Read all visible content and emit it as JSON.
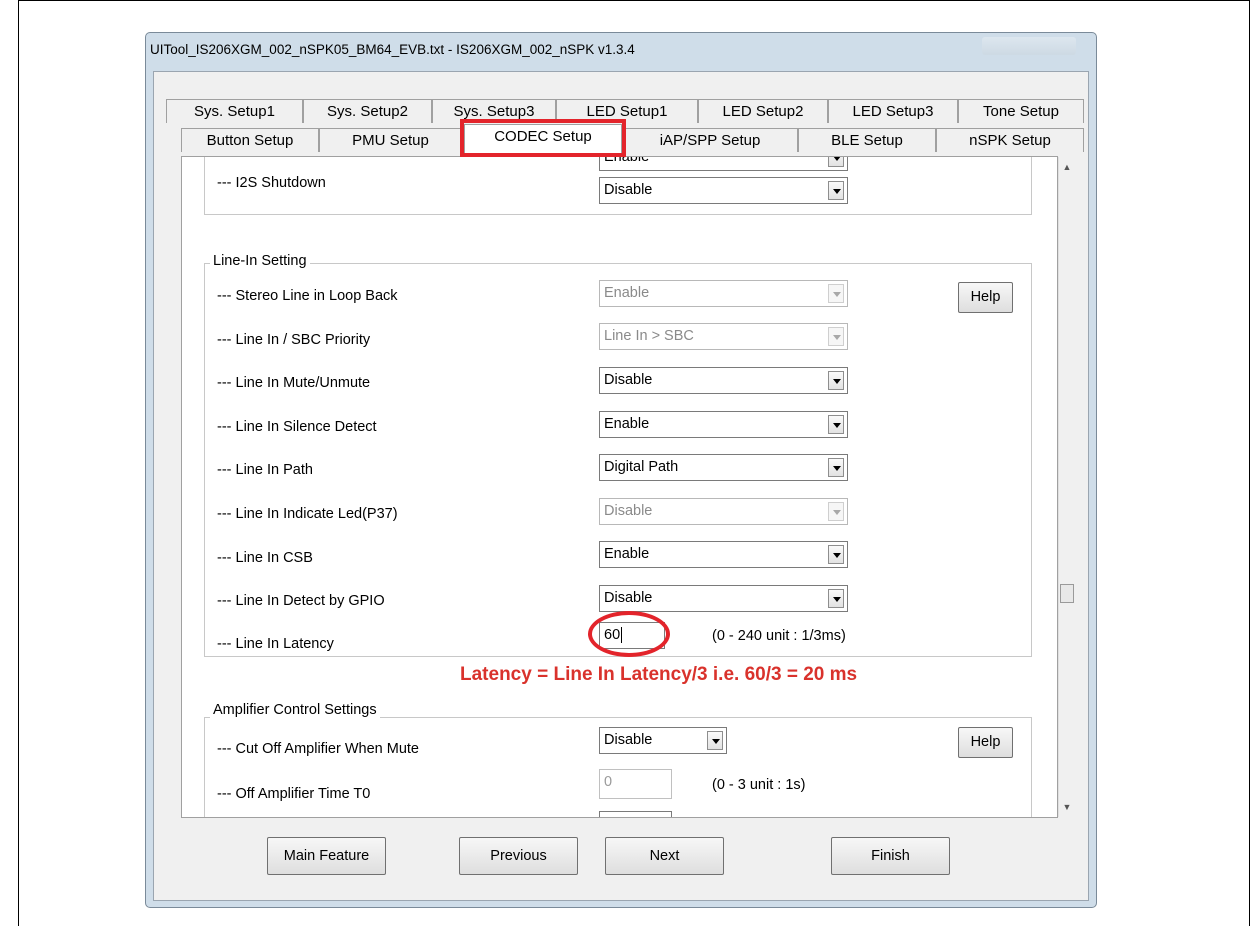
{
  "window": {
    "title": "UITool_IS206XGM_002_nSPK05_BM64_EVB.txt - IS206XGM_002_nSPK v1.3.4"
  },
  "tabs_row1": [
    "Sys. Setup1",
    "Sys. Setup2",
    "Sys. Setup3",
    "LED Setup1",
    "LED Setup2",
    "LED Setup3",
    "Tone Setup"
  ],
  "tabs_row2": [
    "Button Setup",
    "PMU Setup",
    "CODEC Setup",
    "iAP/SPP Setup",
    "BLE Setup",
    "nSPK Setup"
  ],
  "active_tab": "CODEC Setup",
  "i2s": {
    "partial_value": "Enable",
    "label": "--- I2S Shutdown",
    "value": "Disable"
  },
  "line_in": {
    "group_title": "Line-In Setting",
    "help": "Help",
    "rows": [
      {
        "label": "--- Stereo Line in Loop Back",
        "value": "Enable",
        "disabled": true
      },
      {
        "label": "--- Line In / SBC Priority",
        "value": "Line In > SBC",
        "disabled": true
      },
      {
        "label": "--- Line In Mute/Unmute",
        "value": "Disable",
        "disabled": false
      },
      {
        "label": "--- Line In Silence Detect",
        "value": "Enable",
        "disabled": false
      },
      {
        "label": "--- Line In Path",
        "value": "Digital Path",
        "disabled": false
      },
      {
        "label": "--- Line In Indicate Led(P37)",
        "value": "Disable",
        "disabled": true
      },
      {
        "label": "--- Line In CSB",
        "value": "Enable",
        "disabled": false
      },
      {
        "label": "--- Line In Detect by GPIO",
        "value": "Disable",
        "disabled": false
      }
    ],
    "latency_label": "--- Line In Latency",
    "latency_value": "60",
    "latency_range": "(0 - 240 unit : 1/3ms)"
  },
  "annotation": "Latency = Line In Latency/3 i.e. 60/3 = 20 ms",
  "amp": {
    "group_title": "Amplifier Control Settings",
    "help": "Help",
    "cut_off_label": "--- Cut Off Amplifier When Mute",
    "cut_off_value": "Disable",
    "off_time_label": "--- Off Amplifier Time T0",
    "off_time_value": "0",
    "off_time_range": "(0 - 3 unit : 1s)"
  },
  "buttons": {
    "main_feature": "Main Feature",
    "previous": "Previous",
    "next": "Next",
    "finish": "Finish"
  },
  "colors": {
    "highlight": "#e3242b",
    "annotation_text": "#d9322c"
  }
}
